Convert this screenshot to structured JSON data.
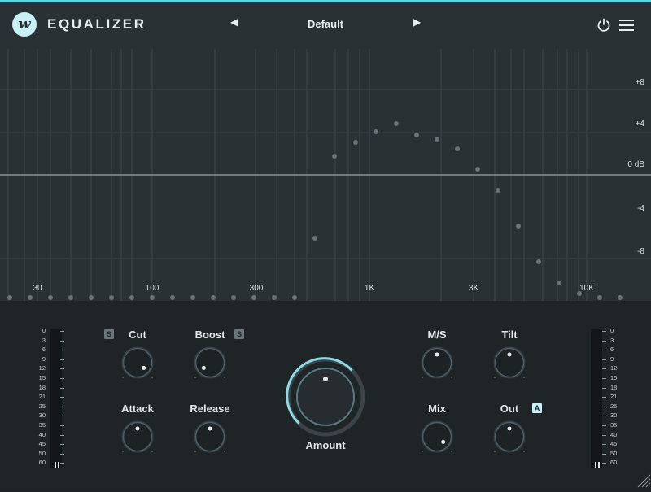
{
  "header": {
    "app_title": "EQUALIZER",
    "logo_text": "w",
    "preset_name": "Default"
  },
  "graph": {
    "db_labels": [
      "+8",
      "+4",
      "0 dB",
      "-4",
      "-8"
    ],
    "freq_labels": [
      "30",
      "100",
      "300",
      "1K",
      "3K",
      "10K"
    ]
  },
  "controls": {
    "cut_label": "Cut",
    "boost_label": "Boost",
    "attack_label": "Attack",
    "release_label": "Release",
    "amount_label": "Amount",
    "ms_label": "M/S",
    "tilt_label": "Tilt",
    "mix_label": "Mix",
    "out_label": "Out",
    "solo_badge": "S",
    "auto_badge": "A"
  },
  "meter_scale": [
    "0",
    "3",
    "6",
    "9",
    "12",
    "15",
    "18",
    "21",
    "25",
    "30",
    "35",
    "40",
    "45",
    "50",
    "60"
  ],
  "colors": {
    "accent": "#5fd3e0",
    "panel": "#2a3135",
    "background": "#1f2427"
  }
}
